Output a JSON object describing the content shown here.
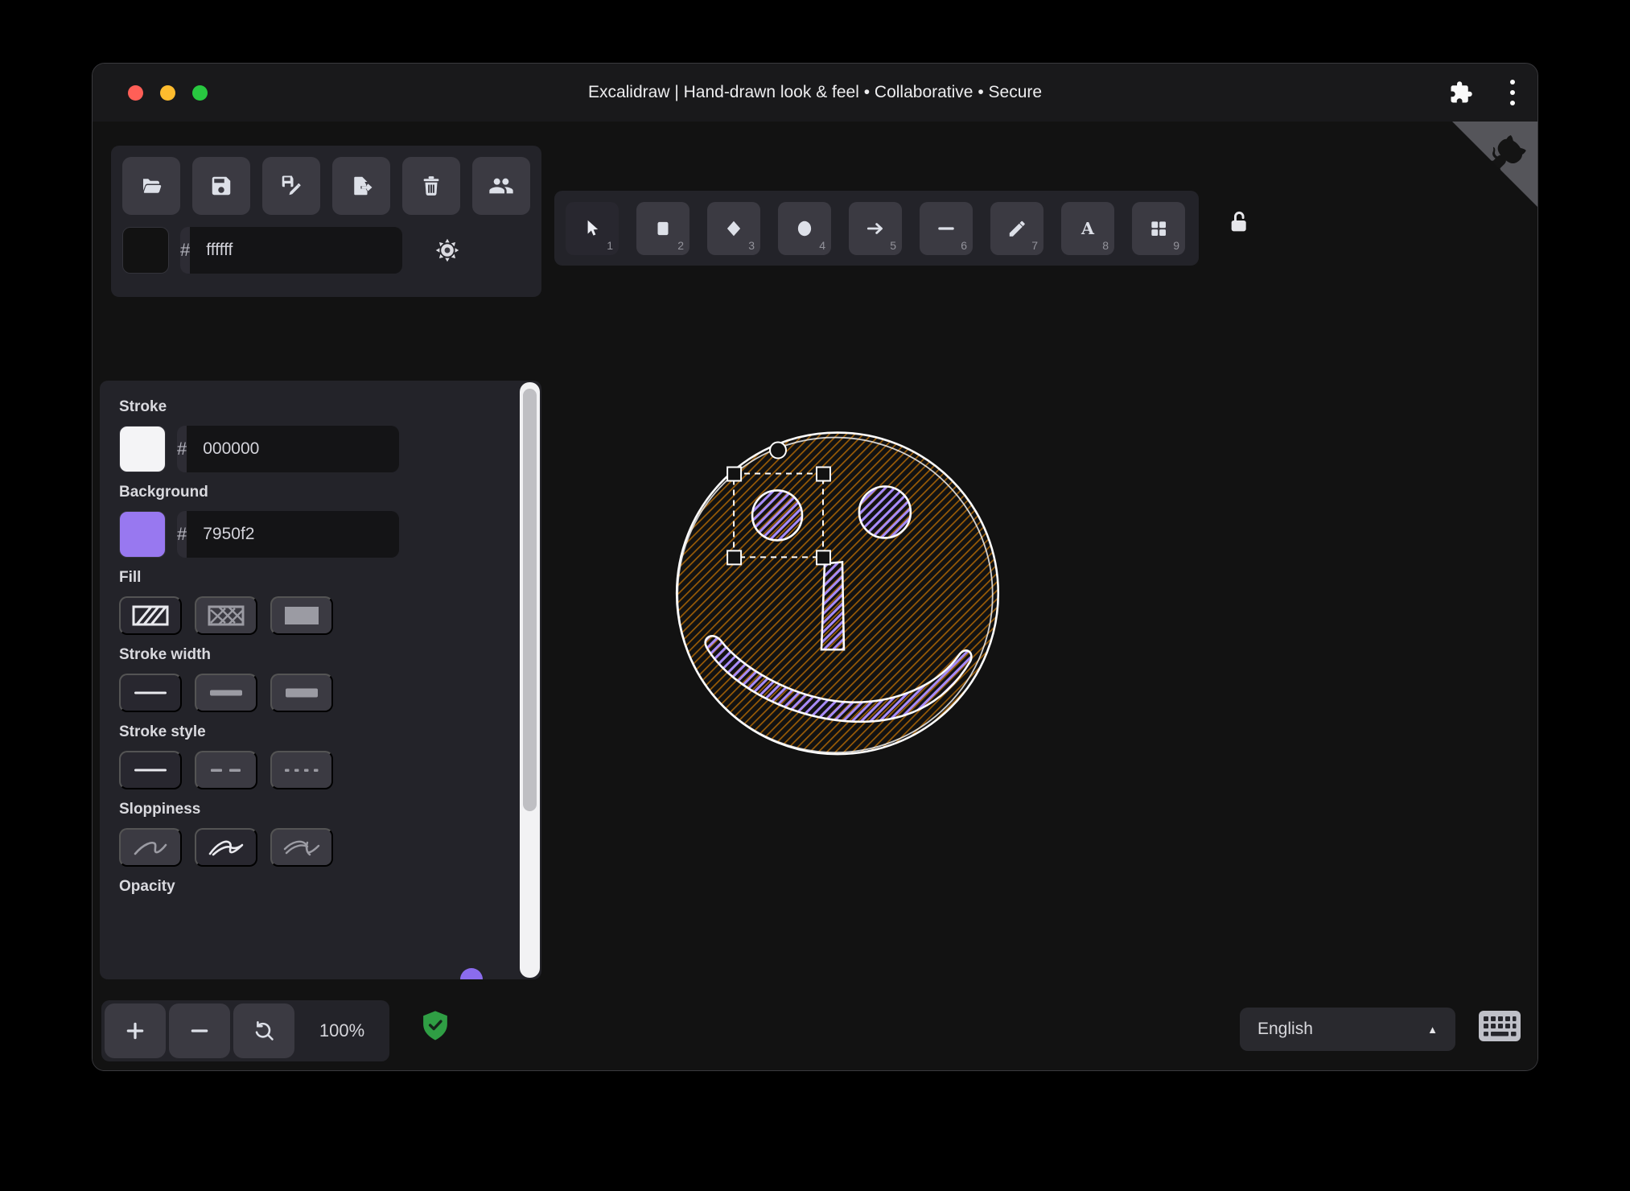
{
  "window": {
    "title": "Excalidraw | Hand-drawn look & feel • Collaborative • Secure",
    "traffic_lights": {
      "close": "#ff5f57",
      "minimize": "#febc2e",
      "zoom": "#28c840"
    },
    "titlebar_icons": [
      "puzzle-extension-icon",
      "kebab-menu-icon"
    ]
  },
  "file_toolbar": {
    "icons": [
      "folder-open-icon",
      "save-icon",
      "save-as-icon",
      "export-icon",
      "trash-icon",
      "collaborators-icon"
    ]
  },
  "canvas_background": {
    "hash_prefix": "#",
    "value": "ffffff",
    "theme_icon": "sun-icon"
  },
  "properties_panel": {
    "stroke": {
      "label": "Stroke",
      "hash_prefix": "#",
      "value": "000000",
      "swatch_color": "#ffffff"
    },
    "background": {
      "label": "Background",
      "hash_prefix": "#",
      "value": "7950f2",
      "swatch_color": "#9878f0"
    },
    "fill": {
      "label": "Fill",
      "options": [
        "hachure",
        "cross-hatch",
        "solid"
      ],
      "selected": "hachure"
    },
    "stroke_width": {
      "label": "Stroke width",
      "options": [
        "thin",
        "bold",
        "extra-bold"
      ],
      "selected": "thin"
    },
    "stroke_style": {
      "label": "Stroke style",
      "options": [
        "solid",
        "dashed",
        "dotted"
      ],
      "selected": "solid"
    },
    "sloppiness": {
      "label": "Sloppiness",
      "options": [
        "architect",
        "artist",
        "cartoonist"
      ],
      "selected": "artist"
    },
    "opacity": {
      "label": "Opacity"
    }
  },
  "toolbar": {
    "tools": [
      {
        "name": "selection",
        "shortcut": "1",
        "active": true
      },
      {
        "name": "rectangle",
        "shortcut": "2",
        "active": false
      },
      {
        "name": "diamond",
        "shortcut": "3",
        "active": false
      },
      {
        "name": "ellipse",
        "shortcut": "4",
        "active": false
      },
      {
        "name": "arrow",
        "shortcut": "5",
        "active": false
      },
      {
        "name": "line",
        "shortcut": "6",
        "active": false
      },
      {
        "name": "draw",
        "shortcut": "7",
        "active": false
      },
      {
        "name": "text",
        "shortcut": "8",
        "active": false
      },
      {
        "name": "shapes",
        "shortcut": "9",
        "active": false
      }
    ],
    "lock_icon": "unlocked-padlock-icon"
  },
  "footer": {
    "zoom_level": "100%",
    "encryption_icon": "green-shield-check-icon",
    "language": "English",
    "keyboard_icon": "keyboard-icon"
  },
  "canvas": {
    "drawing": "smiley-face",
    "selected_element": "left-eye-ellipse",
    "colors": {
      "face_hachure": "#9a5c07",
      "feature_hachure": "#a78bfa",
      "stroke": "#fcfcfc",
      "selection": "#ffffff"
    }
  }
}
